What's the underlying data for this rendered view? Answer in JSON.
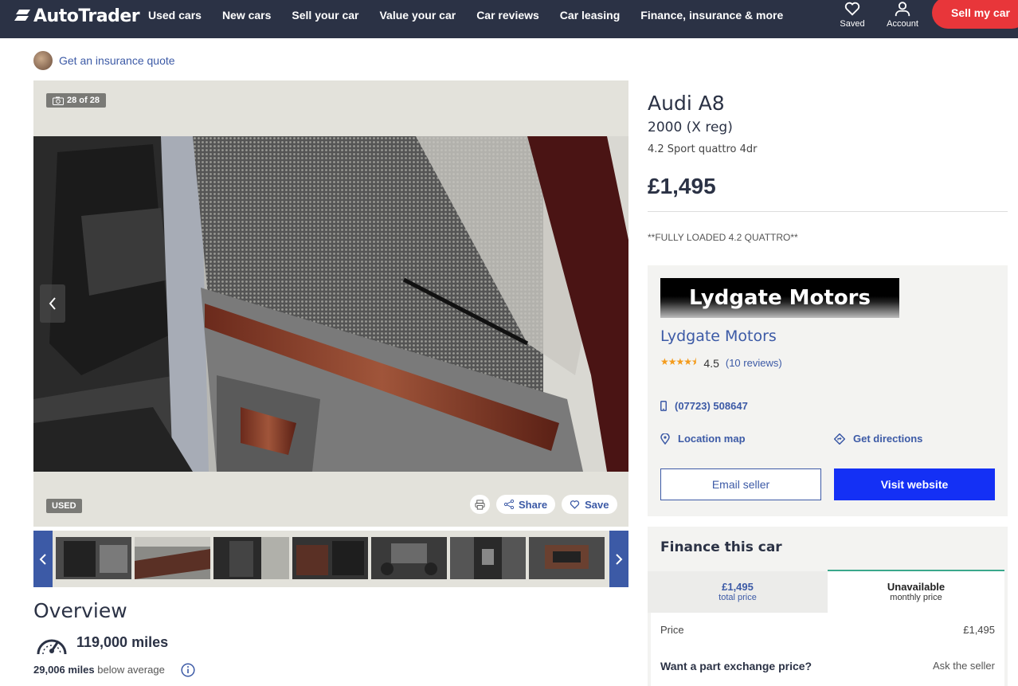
{
  "header": {
    "logo_text": "AutoTrader",
    "nav": [
      "Used cars",
      "New cars",
      "Sell your car",
      "Value your car",
      "Car reviews",
      "Car leasing",
      "Finance, insurance & more"
    ],
    "saved_label": "Saved",
    "account_label": "Account",
    "sell_button": "Sell my car"
  },
  "insurance_link": "Get an insurance quote",
  "gallery": {
    "photo_count": "28 of 28",
    "badge": "USED",
    "share_label": "Share",
    "save_label": "Save"
  },
  "overview": {
    "title": "Overview",
    "miles": "119,000 miles",
    "below_avg_value": "29,006 miles",
    "below_avg_text": "below average"
  },
  "listing": {
    "title": "Audi A8",
    "year": "2000 (X reg)",
    "trim": "4.2 Sport quattro 4dr",
    "price": "£1,495",
    "description": "**FULLY LOADED 4.2 QUATTRO**"
  },
  "dealer": {
    "logo_text": "Lydgate Motors",
    "name": "Lydgate Motors",
    "stars": "★★★★⯨",
    "rating": "4.5",
    "reviews": "(10 reviews)",
    "phone": "(07723) 508647",
    "location_label": "Location map",
    "directions_label": "Get directions",
    "email_button": "Email seller",
    "visit_button": "Visit website"
  },
  "finance": {
    "title": "Finance this car",
    "tab1_main": "£1,495",
    "tab1_sub": "total price",
    "tab2_main": "Unavailable",
    "tab2_sub": "monthly price",
    "price_label": "Price",
    "price_value": "£1,495",
    "px_label": "Want a part exchange price?",
    "px_value": "Ask the seller"
  },
  "colors": {
    "header_bg": "#2b3245",
    "accent_blue": "#3c5aa6",
    "sell_red": "#e8363a",
    "visit_blue": "#1430f5"
  }
}
